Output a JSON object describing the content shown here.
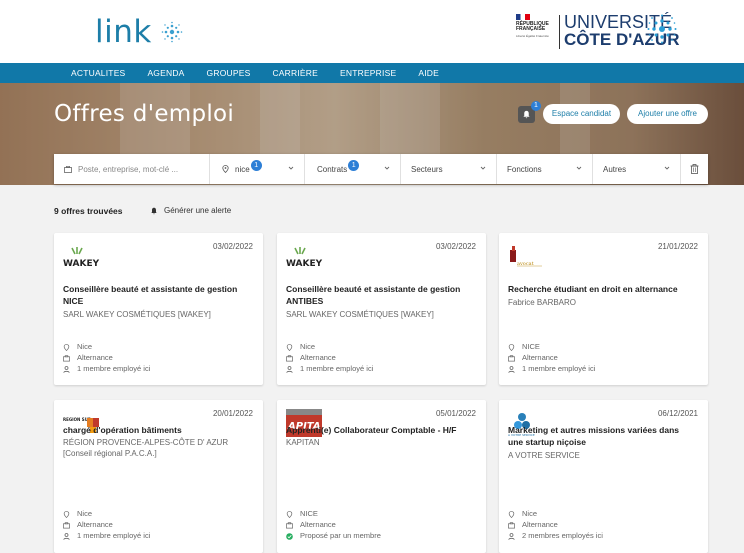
{
  "header": {
    "logo_text": "link",
    "rf_line1": "RÉPUBLIQUE",
    "rf_line2": "FRANÇAISE",
    "rf_motto": "Liberté Égalité Fraternité",
    "uca_line1": "UNIVERSITÉ",
    "uca_line2": "CÔTE D'AZUR"
  },
  "nav": [
    "ACTUALITES",
    "AGENDA",
    "GROUPES",
    "CARRIÈRE",
    "ENTREPRISE",
    "AIDE"
  ],
  "hero": {
    "title": "Offres d'emploi",
    "bell_badge": "1",
    "espace_label": "Espace candidat",
    "ajouter_label": "Ajouter une offre"
  },
  "search": {
    "placeholder": "Poste, entreprise, mot-clé ...",
    "location_value": "nice",
    "location_badge": "1",
    "contrats_label": "Contrats",
    "contrats_badge": "1",
    "secteurs_label": "Secteurs",
    "fonctions_label": "Fonctions",
    "autres_label": "Autres"
  },
  "results": {
    "count_text": "9 offres trouvées",
    "alert_text": "Générer une alerte"
  },
  "cards": [
    {
      "date": "03/02/2022",
      "logo": "WAKEY",
      "title1": "Conseillère beauté et assistante de gestion",
      "title2": "NICE",
      "company1": "SARL WAKEY COSMÉTIQUES [WAKEY]",
      "company2": "",
      "location": "Nice",
      "contract": "Alternance",
      "employees": "1 membre employé ici"
    },
    {
      "date": "03/02/2022",
      "logo": "WAKEY",
      "title1": "Conseillère beauté et assistante de gestion",
      "title2": "ANTIBES",
      "company1": "SARL WAKEY COSMÉTIQUES [WAKEY]",
      "company2": "",
      "location": "Nice",
      "contract": "Alternance",
      "employees": "1 membre employé ici"
    },
    {
      "date": "21/01/2022",
      "logo": "avocat",
      "title1": "Recherche étudiant en droit en alternance",
      "title2": "",
      "company1": "Fabrice BARBARO",
      "company2": "",
      "location": "NICE",
      "contract": "Alternance",
      "employees": "1 membre employé ici"
    },
    {
      "date": "20/01/2022",
      "logo": "REGION SUD",
      "title1": "chargé d'opération bâtiments",
      "title2": "",
      "company1": "RÉGION PROVENCE-ALPES-CÔTE D' AZUR",
      "company2": "[Conseil régional P.A.C.A.]",
      "location": "Nice",
      "contract": "Alternance",
      "employees": "1 membre employé ici"
    },
    {
      "date": "05/01/2022",
      "logo": "APITA",
      "title1": "Apprenti(e) Collaborateur Comptable - H/F",
      "title2": "",
      "company1": "KAPITAN",
      "company2": "",
      "location": "NICE",
      "contract": "Alternance",
      "employees": "Proposé par un membre"
    },
    {
      "date": "06/12/2021",
      "logo": "A VOTRE SERVICE",
      "title1": "Marketing et autres missions variées dans",
      "title2": "une startup niçoise",
      "company1": "A VOTRE SERVICE",
      "company2": "",
      "location": "Nice",
      "contract": "Alternance",
      "employees": "2 membres employés ici"
    }
  ],
  "colors": {
    "brand": "#1178a8",
    "accent": "#2d7fd6",
    "logo": "#1d7ea8"
  }
}
